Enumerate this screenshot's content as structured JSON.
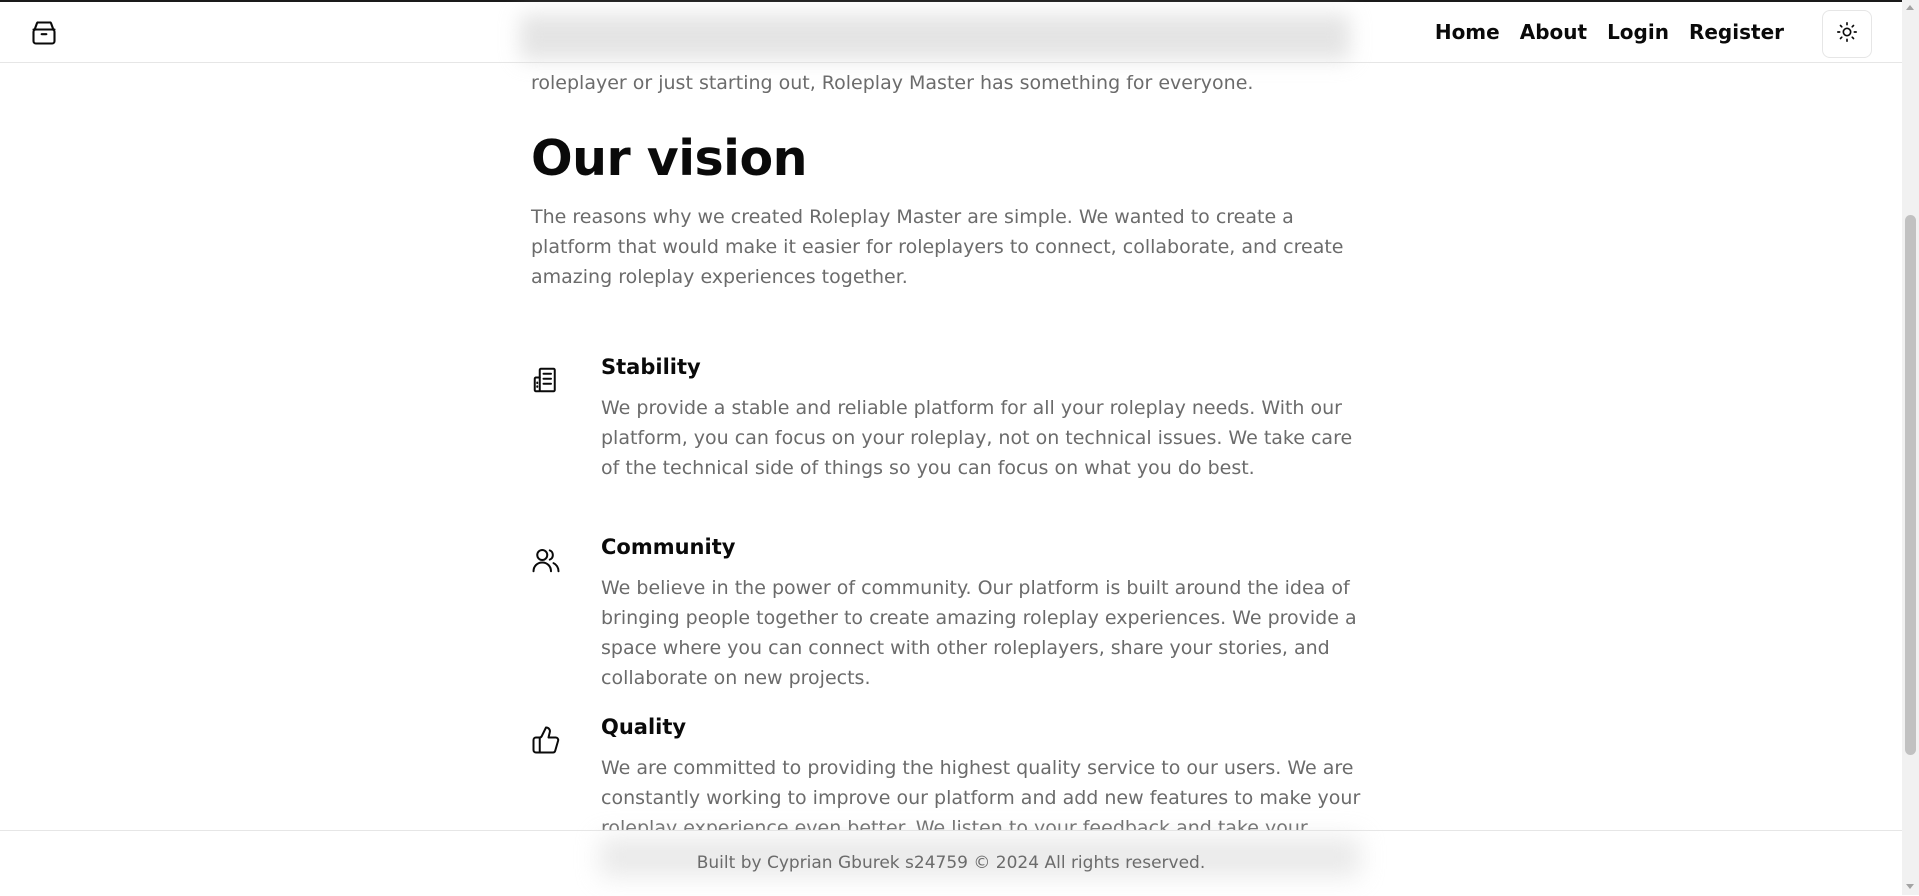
{
  "nav": {
    "logo": "box-icon",
    "links": [
      "Home",
      "About",
      "Login",
      "Register"
    ],
    "theme_toggle": "sun-icon"
  },
  "intro_tail": "roleplayer or just starting out, Roleplay Master has something for everyone.",
  "vision": {
    "title": "Our vision",
    "text": "The reasons why we created Roleplay Master are simple. We wanted to create a platform that would make it easier for roleplayers to connect, collaborate, and create amazing roleplay experiences together."
  },
  "features": [
    {
      "icon": "building-icon",
      "title": "Stability",
      "text": "We provide a stable and reliable platform for all your roleplay needs. With our platform, you can focus on your roleplay, not on technical issues. We take care of the technical side of things so you can focus on what you do best."
    },
    {
      "icon": "users-icon",
      "title": "Community",
      "text": "We believe in the power of community. Our platform is built around the idea of bringing people together to create amazing roleplay experiences. We provide a space where you can connect with other roleplayers, share your stories, and collaborate on new projects."
    },
    {
      "icon": "thumbs-up-icon",
      "title": "Quality",
      "text": "We are committed to providing the highest quality service to our users. We are constantly working to improve our platform and add new features to make your roleplay experience even better. We listen to your feedback and take your suggestions seriously."
    }
  ],
  "footer": {
    "text": "Built by Cyprian Gburek s24759 © 2024 All rights reserved."
  }
}
